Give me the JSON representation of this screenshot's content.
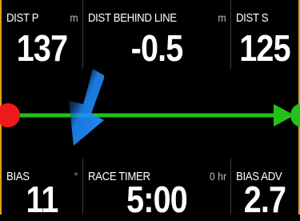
{
  "top_row": [
    {
      "label": "DIST P",
      "unit": "m",
      "value": "137"
    },
    {
      "label": "DIST BEHIND LINE",
      "unit": "m",
      "value": "-0.5"
    },
    {
      "label": "DIST S",
      "unit": "",
      "value": "125"
    }
  ],
  "bottom_row": [
    {
      "label": "BIAS",
      "unit": "°",
      "value": "11"
    },
    {
      "label": "RACE TIMER",
      "unit": "0 hr",
      "value": "5:00"
    },
    {
      "label": "BIAS ADV",
      "unit": "",
      "value": "2.7"
    }
  ],
  "colors": {
    "frame": "#e0a21a",
    "start_line": "#22c21a",
    "port_mark": "#ee1a1a",
    "starboard_mark": "#22c21a",
    "wind_arrow": "#1e8cff"
  },
  "icons": {
    "port_mark": "red-circle",
    "starboard_mark": "green-circle",
    "line_arrow": "arrow-right",
    "wind_arrow": "wind-direction-arrow"
  }
}
